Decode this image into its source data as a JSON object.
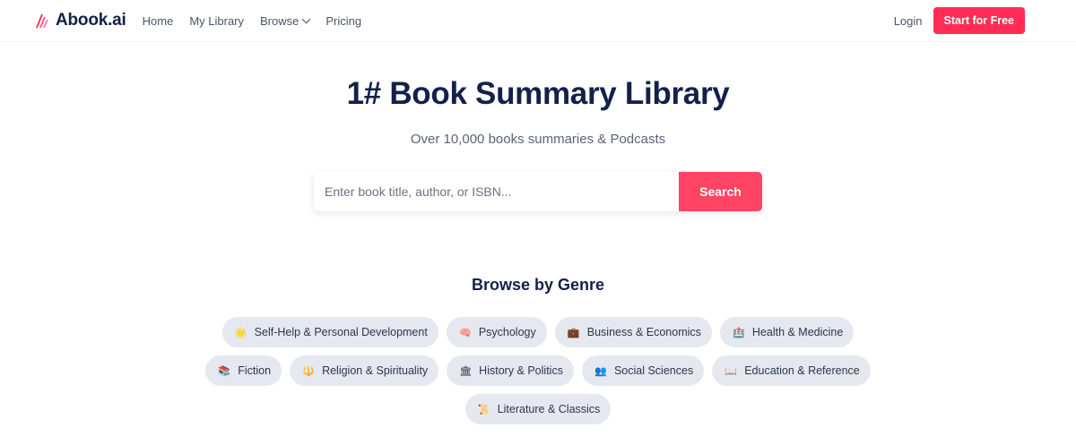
{
  "nav": {
    "logo_text": "Abook.ai",
    "links": [
      "Home",
      "My Library",
      "Browse",
      "Pricing"
    ],
    "login": "Login",
    "cta": "Start for Free"
  },
  "hero": {
    "title": "1# Book Summary Library",
    "subtitle": "Over 10,000 books summaries & Podcasts",
    "search_placeholder": "Enter book title, author, or ISBN...",
    "search_button": "Search"
  },
  "genres": {
    "title": "Browse by Genre",
    "items": [
      {
        "label": "Self-Help & Personal Development",
        "icon": "sun-icon",
        "glyph": "🌟"
      },
      {
        "label": "Psychology",
        "icon": "brain-icon",
        "glyph": "🧠"
      },
      {
        "label": "Business & Economics",
        "icon": "briefcase-icon",
        "glyph": "💼"
      },
      {
        "label": "Health & Medicine",
        "icon": "medical-icon",
        "glyph": "🏥"
      },
      {
        "label": "Fiction",
        "icon": "books-icon",
        "glyph": "📚"
      },
      {
        "label": "Religion & Spirituality",
        "icon": "spiritual-icon",
        "glyph": "🔱"
      },
      {
        "label": "History & Politics",
        "icon": "government-building-icon",
        "glyph": "🏛"
      },
      {
        "label": "Social Sciences",
        "icon": "people-icon",
        "glyph": "👥"
      },
      {
        "label": "Education & Reference",
        "icon": "open-book-icon",
        "glyph": "📖"
      },
      {
        "label": "Literature & Classics",
        "icon": "scroll-icon",
        "glyph": "📜"
      }
    ]
  },
  "colors": {
    "brand": "#ff2d55",
    "navy": "#13214a",
    "chip_bg": "#e5e8ef"
  }
}
